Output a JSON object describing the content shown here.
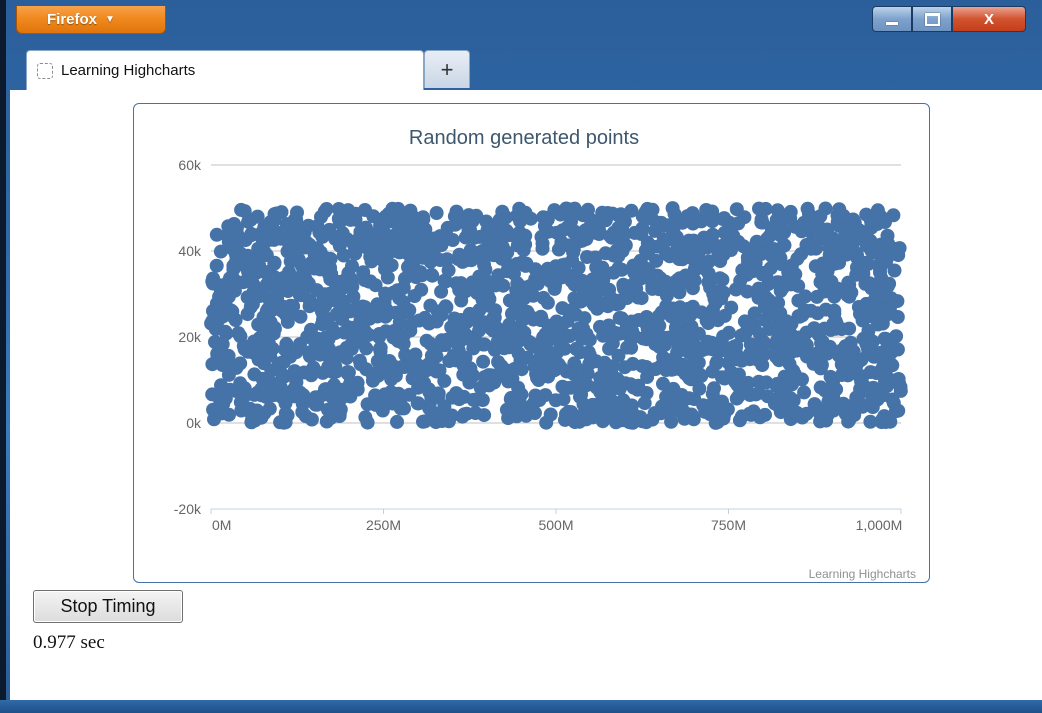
{
  "window": {
    "firefox_button_label": "Firefox",
    "minimize_icon": "minimize-icon",
    "maximize_icon": "maximize-icon",
    "close_label": "X"
  },
  "tabs": [
    {
      "label": "Learning Highcharts",
      "active": true
    }
  ],
  "new_tab_label": "+",
  "chart_data": {
    "type": "scatter",
    "title": "Random generated points",
    "credits": "Learning Highcharts",
    "xlabel": "",
    "ylabel": "",
    "x_ticks": [
      "0M",
      "250M",
      "500M",
      "750M",
      "1,000M"
    ],
    "y_ticks": [
      "60k",
      "40k",
      "20k",
      "0k",
      "-20k"
    ],
    "xlim": [
      0,
      1000000000
    ],
    "ylim": [
      -20000,
      60000
    ],
    "grid": true,
    "marker_color": "#4572a7",
    "series": [
      {
        "point_count": 2000,
        "x_range": [
          0,
          1000000000
        ],
        "y_range": [
          0,
          50000
        ]
      }
    ]
  },
  "controls": {
    "stop_button_label": "Stop Timing",
    "elapsed_text": "0.977 sec"
  }
}
